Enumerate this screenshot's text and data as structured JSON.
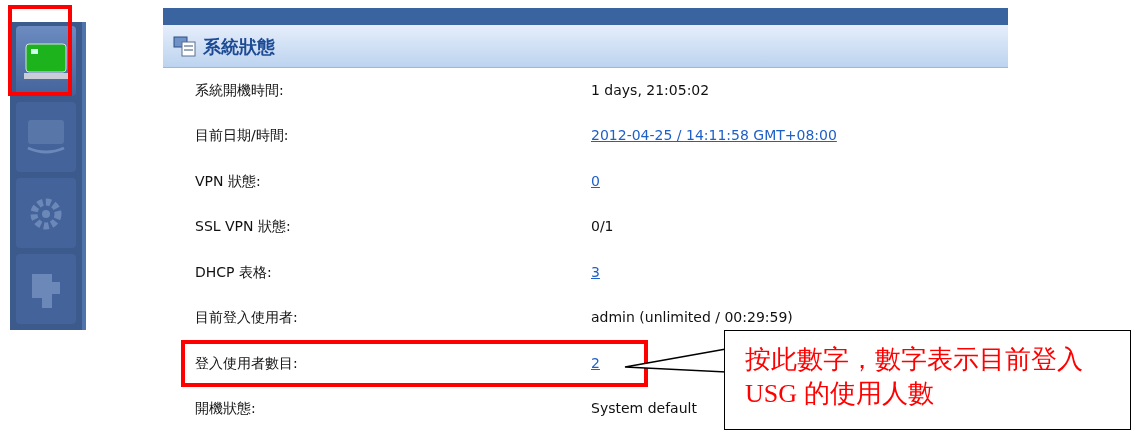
{
  "sidebar": {
    "items": [
      {
        "kind": "monitor",
        "selected": true,
        "highlighted": true
      },
      {
        "kind": "screen",
        "selected": false,
        "highlighted": false
      },
      {
        "kind": "gear",
        "selected": false,
        "highlighted": false
      },
      {
        "kind": "puzzle",
        "selected": false,
        "highlighted": false
      }
    ]
  },
  "panel": {
    "title": "系統狀態",
    "rows": [
      {
        "label": "系統開機時間:",
        "value": "1 days, 21:05:02",
        "kind": "text",
        "highlighted": false
      },
      {
        "label": "目前日期/時間:",
        "value": "2012-04-25 / 14:11:58 GMT+08:00",
        "kind": "link",
        "highlighted": false
      },
      {
        "label": "VPN 狀態:",
        "value": "0",
        "kind": "link",
        "highlighted": false
      },
      {
        "label": "SSL VPN 狀態:",
        "value": "0/1",
        "kind": "text",
        "highlighted": false
      },
      {
        "label": "DHCP 表格:",
        "value": "3",
        "kind": "link",
        "highlighted": false
      },
      {
        "label": "目前登入使用者:",
        "value": "admin (unlimited / 00:29:59)",
        "kind": "text",
        "highlighted": false
      },
      {
        "label": "登入使用者數目:",
        "value": "2",
        "kind": "link",
        "highlighted": true
      },
      {
        "label": "開機狀態:",
        "value": "System default",
        "kind": "text",
        "highlighted": false
      }
    ]
  },
  "callout": {
    "text": "按此數字，數字表示目前登入 USG 的使用人數"
  }
}
